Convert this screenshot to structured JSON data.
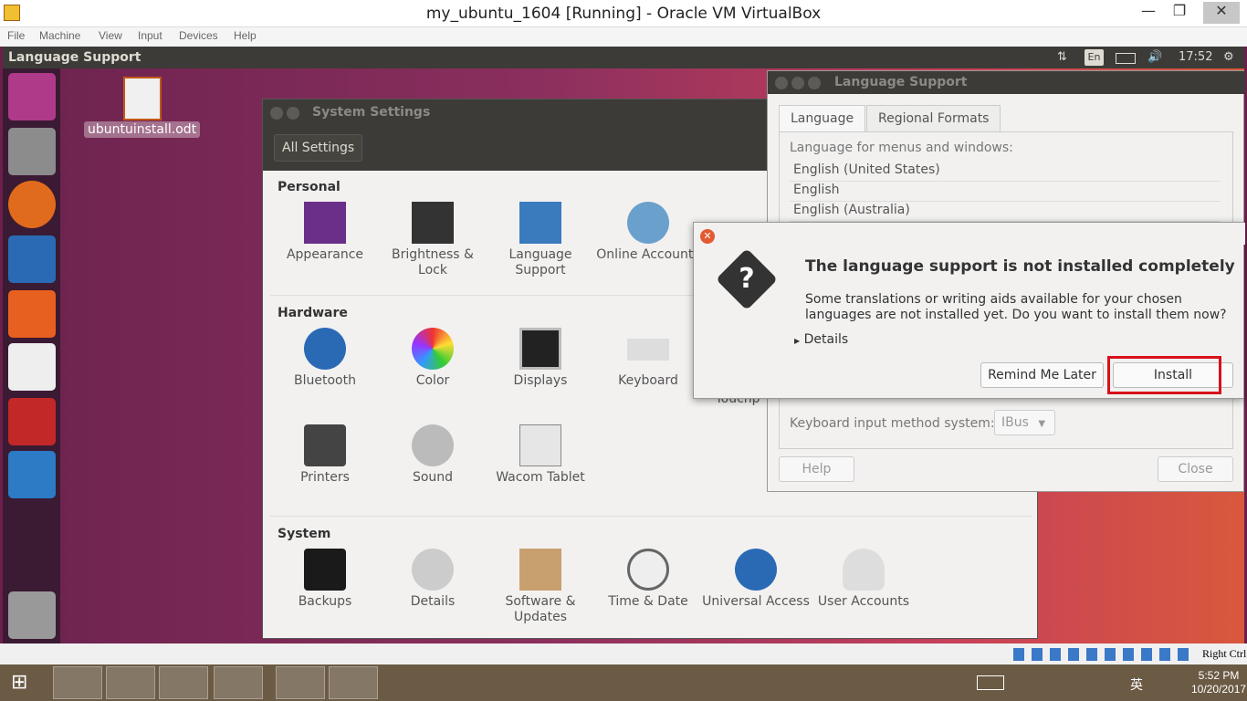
{
  "host": {
    "title": "my_ubuntu_1604 [Running] - Oracle VM VirtualBox",
    "menu": [
      "File",
      "Machine",
      "View",
      "Input",
      "Devices",
      "Help"
    ],
    "window_controls": {
      "minimize": "—",
      "maximize": "❐",
      "close": "✕"
    },
    "status_keyboard": "Right Ctrl",
    "clock_time": "5:52 PM",
    "clock_date": "10/20/2017",
    "ime": "英"
  },
  "panel": {
    "title": "Language Support",
    "lang": "En",
    "time": "17:52",
    "icons": [
      "network-icon",
      "battery-icon",
      "volume-icon",
      "gear-icon"
    ]
  },
  "desktop": {
    "file": "ubuntuinstall.odt"
  },
  "sys": {
    "title": "System Settings",
    "all_settings": "All Settings",
    "personal": "Personal",
    "hardware": "Hardware",
    "system": "System",
    "personal_items": [
      "Appearance",
      "Brightness & Lock",
      "Language Support",
      "Online Accounts"
    ],
    "hardware_items": [
      "Bluetooth",
      "Color",
      "Displays",
      "Keyboard"
    ],
    "hardware2_items": [
      "Printers",
      "Sound",
      "Wacom Tablet"
    ],
    "system_items": [
      "Backups",
      "Details",
      "Software & Updates",
      "Time & Date",
      "Universal Access",
      "User Accounts"
    ],
    "partial": "Touchp"
  },
  "lang": {
    "title": "Language Support",
    "tab_language": "Language",
    "tab_regional": "Regional Formats",
    "menus_label": "Language for menus and windows:",
    "languages": [
      "English (United States)",
      "English",
      "English (Australia)"
    ],
    "input_label": "Keyboard input method system:",
    "input_value": "IBus",
    "help": "Help",
    "close": "Close"
  },
  "dialog": {
    "heading": "The language support is not installed completely",
    "message": "Some translations or writing aids available for your chosen languages are not installed yet. Do you want to install them now?",
    "details": "Details",
    "remind": "Remind Me Later",
    "install": "Install"
  },
  "colors": {
    "highlight": "#d8101a",
    "panel": "#3c3b37",
    "ubuntu_orange": "#e25a30"
  }
}
